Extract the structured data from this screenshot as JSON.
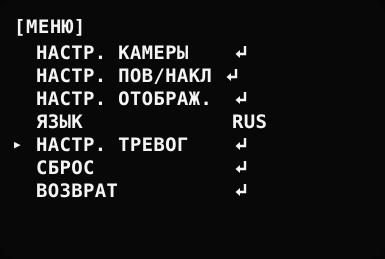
{
  "menu": {
    "title": "[МЕНЮ]",
    "selected_marker": "▶",
    "items": [
      {
        "label": "НАСТР. КАМЕРЫ",
        "value": "",
        "icon": "enter-icon",
        "selected": false
      },
      {
        "label": "НАСТР. ПОВ/НАКЛ",
        "value": "",
        "icon": "enter-icon",
        "selected": false
      },
      {
        "label": "НАСТР. ОТОБРАЖ.",
        "value": "",
        "icon": "enter-icon",
        "selected": false
      },
      {
        "label": "ЯЗЫК",
        "value": "RUS",
        "icon": "",
        "selected": false
      },
      {
        "label": "НАСТР. ТРЕВОГ",
        "value": "",
        "icon": "enter-icon",
        "selected": true
      },
      {
        "label": "СБРОС",
        "value": "",
        "icon": "enter-icon",
        "selected": false
      },
      {
        "label": "ВОЗВРАТ",
        "value": "",
        "icon": "enter-icon",
        "selected": false
      }
    ]
  }
}
